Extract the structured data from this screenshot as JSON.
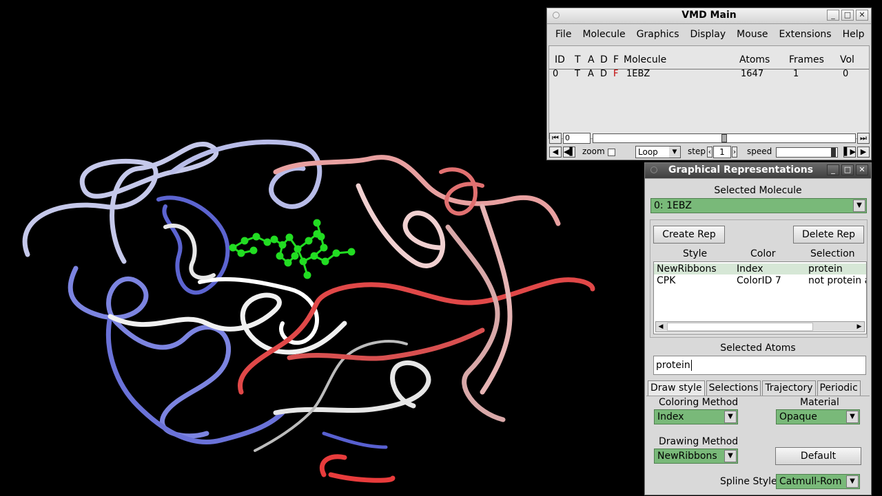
{
  "vmd_main": {
    "title": "VMD Main",
    "window_buttons": [
      "_",
      "□",
      "✕"
    ],
    "menu": [
      "File",
      "Molecule",
      "Graphics",
      "Display",
      "Mouse",
      "Extensions",
      "Help"
    ],
    "table": {
      "headers": [
        "ID",
        "T",
        "A",
        "D",
        "F",
        "Molecule",
        "Atoms",
        "Frames",
        "Vol"
      ],
      "rows": [
        {
          "id": "0",
          "t": "T",
          "a": "A",
          "d": "D",
          "f": "F",
          "molecule": "1EBZ",
          "atoms": "1647",
          "frames": "1",
          "vol": "0"
        }
      ]
    },
    "frame_value": "0",
    "frame_fraction": 0.5,
    "zoom_label": "zoom",
    "loop_value": "Loop",
    "step_label": "step",
    "step_value": "1",
    "speed_label": "speed",
    "speed_fraction": 0.97,
    "f_color": "#c00000"
  },
  "graph_reps": {
    "title": "Graphical Representations",
    "window_buttons": [
      "_",
      "□",
      "✕"
    ],
    "selected_molecule_label": "Selected Molecule",
    "selected_molecule_value": "0: 1EBZ",
    "create_rep": "Create Rep",
    "delete_rep": "Delete Rep",
    "rep_headers": [
      "Style",
      "Color",
      "Selection"
    ],
    "reps": [
      {
        "style": "NewRibbons",
        "color": "Index",
        "selection": "protein"
      },
      {
        "style": "CPK",
        "color": "ColorID 7",
        "selection": "not protein a"
      }
    ],
    "selected_atoms_label": "Selected Atoms",
    "selected_atoms_value": "protein",
    "tabs": [
      "Draw style",
      "Selections",
      "Trajectory",
      "Periodic"
    ],
    "coloring_method_label": "Coloring Method",
    "coloring_method_value": "Index",
    "material_label": "Material",
    "material_value": "Opaque",
    "drawing_method_label": "Drawing Method",
    "drawing_method_value": "NewRibbons",
    "default_button": "Default",
    "spline_style_label": "Spline Style",
    "spline_style_value": "Catmull-Rom",
    "accent_green": "#79b979"
  },
  "viewport": {
    "ribbon_colors": [
      "#7f87e6",
      "#c9cbe8",
      "#ffffff",
      "#e8b7b7",
      "#e04444"
    ],
    "ligand_color": "#22dd22"
  }
}
